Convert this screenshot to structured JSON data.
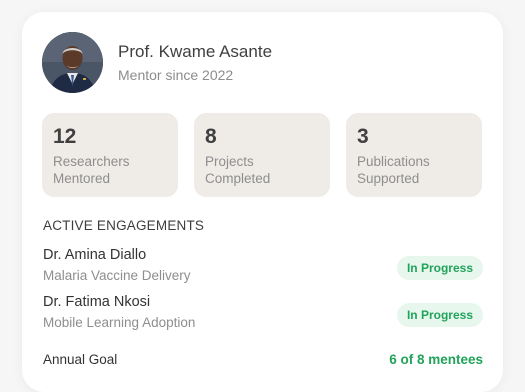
{
  "profile": {
    "name": "Prof. Kwame Asante",
    "since": "Mentor since 2022"
  },
  "stats": [
    {
      "value": "12",
      "label_line1": "Researchers",
      "label_line2": "Mentored"
    },
    {
      "value": "8",
      "label_line1": "Projects",
      "label_line2": "Completed"
    },
    {
      "value": "3",
      "label_line1": "Publications",
      "label_line2": "Supported"
    }
  ],
  "engagements": {
    "title": "ACTIVE ENGAGEMENTS",
    "items": [
      {
        "name": "Dr. Amina Diallo",
        "project": "Malaria Vaccine Delivery",
        "status": "In Progress"
      },
      {
        "name": "Dr. Fatima Nkosi",
        "project": "Mobile Learning Adoption",
        "status": "In Progress"
      }
    ]
  },
  "goal": {
    "label": "Annual Goal",
    "value": "6 of 8 mentees"
  },
  "colors": {
    "accent_green": "#21a35a",
    "badge_bg": "#e8f7ee",
    "stat_bg": "#efece8"
  }
}
